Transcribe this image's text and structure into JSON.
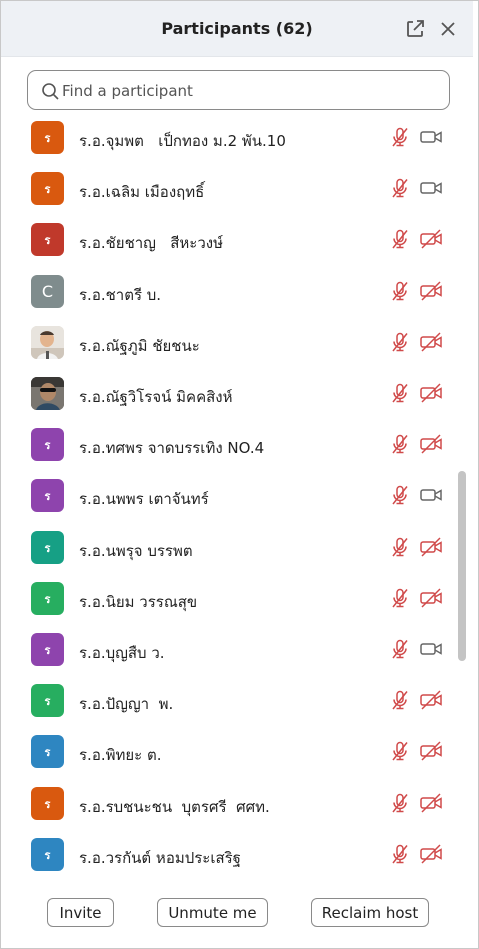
{
  "header": {
    "title": "Participants (62)",
    "popout_icon": "popout-icon",
    "close_icon": "close-icon"
  },
  "search": {
    "placeholder": "Find a participant",
    "value": ""
  },
  "colors": {
    "red": "#d04a4a",
    "orange": "#d9590f",
    "purple": "#8e44ad",
    "teal": "#16a085",
    "green": "#27ae60",
    "blue": "#2e86c1",
    "gray": "#7f8c8d",
    "icon_gray": "#666666"
  },
  "participants": [
    {
      "initial": "ร",
      "name": "ร.อ.จุมพต   เป็กทอง ม.2 พัน.10",
      "avatar_color": "#d9590f",
      "mic": "muted",
      "video": "on"
    },
    {
      "initial": "ร",
      "name": "ร.อ.เฉลิม เมืองฤทธิ์",
      "avatar_color": "#d9590f",
      "mic": "muted",
      "video": "on"
    },
    {
      "initial": "ร",
      "name": "ร.อ.ชัยชาญ   สีหะวงษ์",
      "avatar_color": "#c0392b",
      "mic": "muted",
      "video": "off"
    },
    {
      "initial": "C",
      "name": "ร.อ.ชาตรี บ.",
      "avatar_color": "#7f8c8d",
      "mic": "muted",
      "video": "off"
    },
    {
      "initial": "",
      "name": "ร.อ.ณัฐภูมิ ชัยชนะ",
      "avatar_color": "#d9d3cc",
      "photo": "photo-light",
      "mic": "muted",
      "video": "off"
    },
    {
      "initial": "",
      "name": "ร.อ.ณัฐวิโรจน์ มิคคสิงห์",
      "avatar_color": "#3b3b3b",
      "photo": "photo-dark",
      "mic": "muted",
      "video": "off"
    },
    {
      "initial": "ร",
      "name": "ร.อ.ทศพร จาดบรรเทิง NO.4",
      "avatar_color": "#8e44ad",
      "mic": "muted",
      "video": "off"
    },
    {
      "initial": "ร",
      "name": "ร.อ.นพพร เตาจันทร์",
      "avatar_color": "#8e44ad",
      "mic": "muted",
      "video": "on"
    },
    {
      "initial": "ร",
      "name": "ร.อ.นพรุจ บรรพต",
      "avatar_color": "#16a085",
      "mic": "muted",
      "video": "off"
    },
    {
      "initial": "ร",
      "name": "ร.อ.นิยม วรรณสุข",
      "avatar_color": "#27ae60",
      "mic": "muted",
      "video": "off"
    },
    {
      "initial": "ร",
      "name": "ร.อ.บุญสืบ ว.",
      "avatar_color": "#8e44ad",
      "mic": "muted",
      "video": "on"
    },
    {
      "initial": "ร",
      "name": "ร.อ.ปัญญา  พ.",
      "avatar_color": "#27ae60",
      "mic": "muted",
      "video": "off"
    },
    {
      "initial": "ร",
      "name": "ร.อ.พิทยะ ต.",
      "avatar_color": "#2e86c1",
      "mic": "muted",
      "video": "off"
    },
    {
      "initial": "ร",
      "name": "ร.อ.รบชนะชน  บุตรศรี  ศศท.",
      "avatar_color": "#d9590f",
      "mic": "muted",
      "video": "off"
    },
    {
      "initial": "ร",
      "name": "ร.อ.วรกันต์ หอมประเสริฐ",
      "avatar_color": "#2e86c1",
      "mic": "muted",
      "video": "off"
    }
  ],
  "footer": {
    "invite": "Invite",
    "unmute": "Unmute me",
    "reclaim": "Reclaim host"
  }
}
